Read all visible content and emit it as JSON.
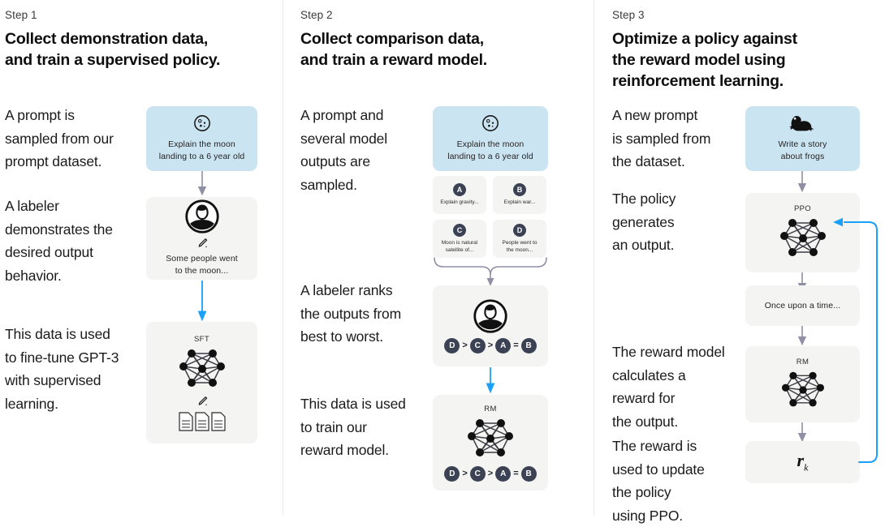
{
  "diagram": {
    "title": "RLHF three-step training diagram",
    "colors": {
      "prompt_box": "#cbe4f2",
      "neutral_box": "#f4f4f2",
      "gray_arrow": "#8f90a6",
      "blue_arrow": "#18a0fb",
      "badge": "#3b4254",
      "divider": "#ececec"
    }
  },
  "columns": [
    {
      "step_label": "Step 1",
      "title": "Collect demonstration data,\nand train a supervised policy.",
      "paragraphs": [
        "A prompt is\nsampled from our\nprompt dataset.",
        "A labeler\ndemonstrates the\ndesired output\nbehavior.",
        "This data is used\nto fine-tune GPT-3\nwith supervised\nlearning."
      ],
      "prompt_card": {
        "icon": "moon-icon",
        "text": "Explain the moon\nlanding to a 6 year old"
      },
      "labeler_card": {
        "icon": "labeler-avatar-icon",
        "pencil_icon": "pencil-icon",
        "text": "Some people went\nto the moon..."
      },
      "sft_card": {
        "caption": "SFT",
        "network_icon": "neural-network-icon",
        "pencil_icon": "pencil-icon",
        "documents_icon": "documents-icon"
      }
    },
    {
      "step_label": "Step 2",
      "title": "Collect comparison data,\nand train a reward model.",
      "paragraphs": [
        "A prompt and\nseveral model\noutputs are\nsampled.",
        "A labeler ranks\nthe outputs from\nbest to worst.",
        "This data is used\nto train our\nreward model."
      ],
      "prompt_card": {
        "icon": "moon-icon",
        "text": "Explain the moon\nlanding to a 6 year old"
      },
      "options": [
        {
          "badge": "A",
          "text": "Explain gravity..."
        },
        {
          "badge": "B",
          "text": "Explain war..."
        },
        {
          "badge": "C",
          "text": "Moon is natural\nsatellite of..."
        },
        {
          "badge": "D",
          "text": "People went to\nthe moon..."
        }
      ],
      "rank_card": {
        "icon": "labeler-avatar-icon",
        "ranking": [
          "D",
          ">",
          "C",
          ">",
          "A",
          "=",
          "B"
        ]
      },
      "rm_card": {
        "caption": "RM",
        "network_icon": "neural-network-icon",
        "ranking": [
          "D",
          ">",
          "C",
          ">",
          "A",
          "=",
          "B"
        ]
      }
    },
    {
      "step_label": "Step 3",
      "title": "Optimize a policy against\nthe reward model using\nreinforcement learning.",
      "paragraphs": [
        "A new prompt\nis sampled from\nthe dataset.",
        "The policy\ngenerates\nan output.",
        "The reward model\ncalculates a\nreward for\nthe output.",
        "The reward is\nused to update\nthe policy\nusing PPO."
      ],
      "prompt_card": {
        "icon": "frog-icon",
        "text": "Write a story\nabout frogs"
      },
      "ppo_card": {
        "caption": "PPO",
        "network_icon": "neural-network-icon"
      },
      "output_card": {
        "text": "Once upon a time..."
      },
      "rm_card": {
        "caption": "RM",
        "network_icon": "neural-network-icon"
      },
      "reward_card": {
        "symbol": "r",
        "subscript": "k"
      }
    }
  ]
}
